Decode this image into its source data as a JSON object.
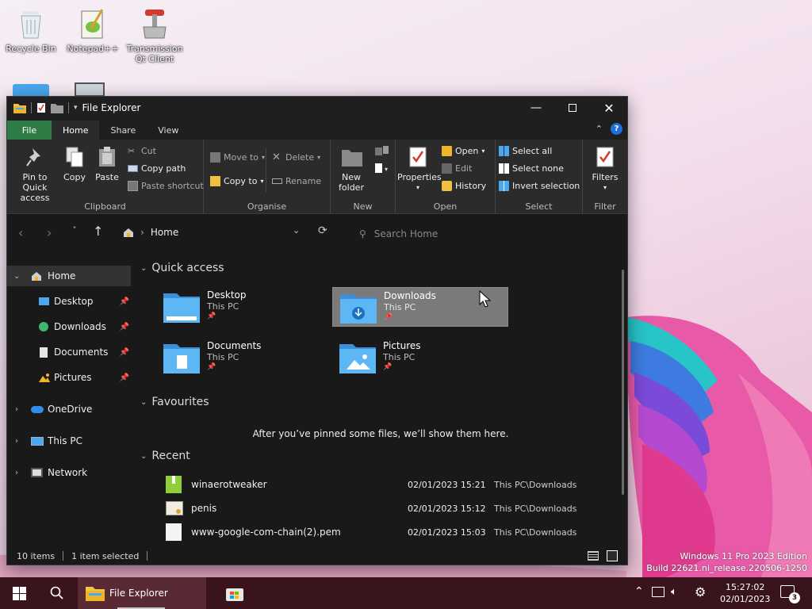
{
  "desktop": {
    "icons": [
      {
        "label": "Recycle Bin"
      },
      {
        "label": "Notepad++"
      },
      {
        "label": "Transmission Qt Client"
      }
    ],
    "watermark": {
      "line1": "Windows 11 Pro 2023 Edition",
      "line2": "Build 22621.ni_release.220506-1250"
    }
  },
  "window": {
    "title": "File Explorer",
    "tabs": [
      "File",
      "Home",
      "Share",
      "View"
    ],
    "active_tab": "Home",
    "help": "?"
  },
  "ribbon": {
    "clipboard": {
      "label": "Clipboard",
      "pin": "Pin to Quick access",
      "copy": "Copy",
      "paste": "Paste",
      "cut": "Cut",
      "copy_path": "Copy path",
      "paste_shortcut": "Paste shortcut"
    },
    "organise": {
      "label": "Organise",
      "move_to": "Move to",
      "copy_to": "Copy to",
      "delete": "Delete",
      "rename": "Rename"
    },
    "new": {
      "label": "New",
      "new_folder": "New folder"
    },
    "open": {
      "label": "Open",
      "properties": "Properties",
      "open": "Open",
      "edit": "Edit",
      "history": "History"
    },
    "select": {
      "label": "Select",
      "select_all": "Select all",
      "select_none": "Select none",
      "invert_selection": "Invert selection"
    },
    "filter": {
      "label": "Filter",
      "filters": "Filters"
    }
  },
  "address": {
    "breadcrumb": "Home",
    "search_placeholder": "Search Home"
  },
  "sidebar": {
    "items": [
      {
        "label": "Home"
      },
      {
        "label": "Desktop"
      },
      {
        "label": "Downloads"
      },
      {
        "label": "Documents"
      },
      {
        "label": "Pictures"
      },
      {
        "label": "OneDrive"
      },
      {
        "label": "This PC"
      },
      {
        "label": "Network"
      }
    ]
  },
  "main": {
    "quick_access": {
      "heading": "Quick access",
      "items": [
        {
          "name": "Desktop",
          "location": "This PC"
        },
        {
          "name": "Downloads",
          "location": "This PC"
        },
        {
          "name": "Documents",
          "location": "This PC"
        },
        {
          "name": "Pictures",
          "location": "This PC"
        }
      ]
    },
    "favourites": {
      "heading": "Favourites",
      "empty_message": "After you’ve pinned some files, we’ll show them here."
    },
    "recent": {
      "heading": "Recent",
      "items": [
        {
          "name": "winaerotweaker",
          "date": "02/01/2023 15:21",
          "location": "This PC\\Downloads"
        },
        {
          "name": "penis",
          "date": "02/01/2023 15:12",
          "location": "This PC\\Downloads"
        },
        {
          "name": "www-google-com-chain(2).pem",
          "date": "02/01/2023 15:03",
          "location": "This PC\\Downloads"
        }
      ]
    }
  },
  "status": {
    "items": "10 items",
    "selected": "1 item selected"
  },
  "taskbar": {
    "app_label": "File Explorer",
    "time": "15:27:02",
    "date": "02/01/2023",
    "notification_count": "3"
  },
  "colors": {
    "window_bg": "#191919",
    "ribbon_bg": "#2b2b2b",
    "file_tab": "#2e7d46",
    "folder_blue": "#4aa8f0",
    "taskbar_bg": "#3a141c",
    "selection": "#7a7a7a"
  }
}
